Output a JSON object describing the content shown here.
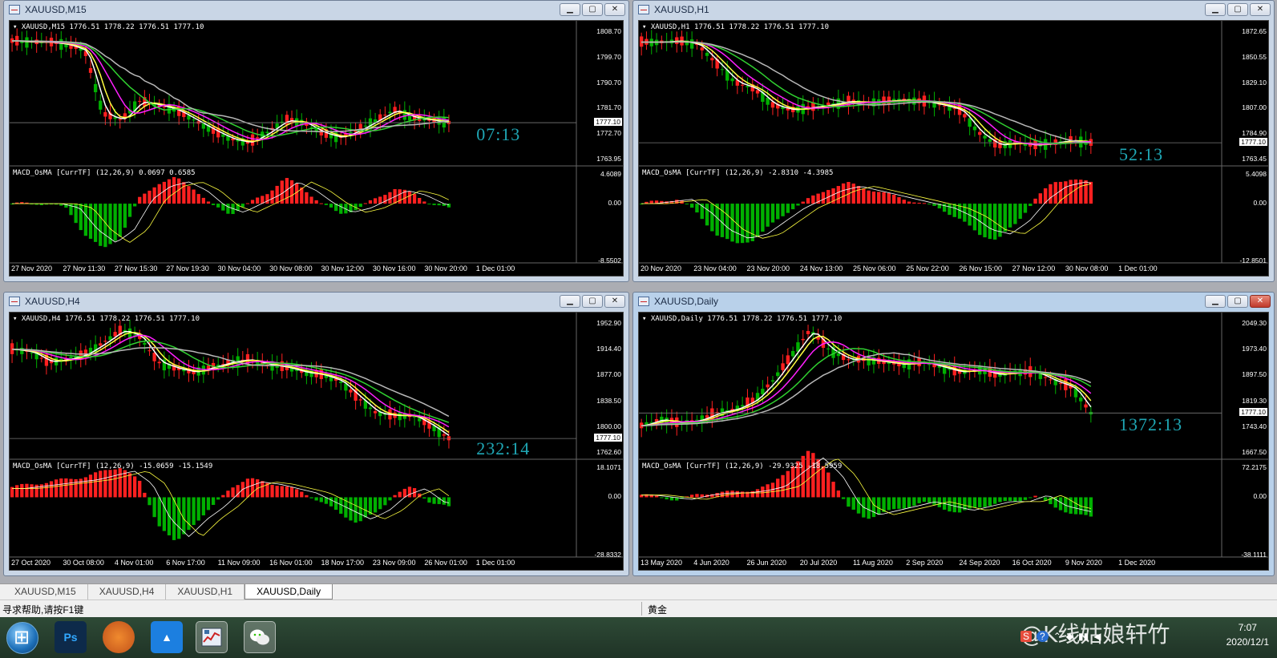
{
  "windows": [
    {
      "id": "m15",
      "title": "XAUUSD,M15",
      "info": "XAUUSD,M15  1776.51 1778.22 1776.51 1777.10",
      "macd_info": "MACD_OsMA [CurrTF] (12,26,9) 0.0697 0.6585",
      "timer": "07:13",
      "current_price": "1777.10",
      "price_labels": [
        "1808.70",
        "1799.70",
        "1790.70",
        "1781.70",
        "1772.70",
        "1763.95"
      ],
      "macd_labels": [
        "4.6089",
        "0.00",
        "-8.5502"
      ],
      "time_labels": [
        "27 Nov 2020",
        "27 Nov 11:30",
        "27 Nov 15:30",
        "27 Nov 19:30",
        "30 Nov 04:00",
        "30 Nov 08:00",
        "30 Nov 12:00",
        "30 Nov 16:00",
        "30 Nov 20:00",
        "1 Dec 01:00"
      ],
      "active": false
    },
    {
      "id": "h1",
      "title": "XAUUSD,H1",
      "info": "XAUUSD,H1  1776.51 1778.22 1776.51 1777.10",
      "macd_info": "MACD_OsMA [CurrTF] (12,26,9) -2.8310 -4.3985",
      "timer": "52:13",
      "current_price": "1777.10",
      "price_labels": [
        "1872.65",
        "1850.55",
        "1829.10",
        "1807.00",
        "1784.90",
        "1763.45"
      ],
      "macd_labels": [
        "5.4098",
        "0.00",
        "-12.8501"
      ],
      "time_labels": [
        "20 Nov 2020",
        "23 Nov 04:00",
        "23 Nov 20:00",
        "24 Nov 13:00",
        "25 Nov 06:00",
        "25 Nov 22:00",
        "26 Nov 15:00",
        "27 Nov 12:00",
        "30 Nov 08:00",
        "1 Dec 01:00"
      ],
      "active": false
    },
    {
      "id": "h4",
      "title": "XAUUSD,H4",
      "info": "XAUUSD,H4  1776.51 1778.22 1776.51 1777.10",
      "macd_info": "MACD_OsMA [CurrTF] (12,26,9) -15.0659 -15.1549",
      "timer": "232:14",
      "current_price": "1777.10",
      "price_labels": [
        "1952.90",
        "1914.40",
        "1877.00",
        "1838.50",
        "1800.00",
        "1762.60"
      ],
      "macd_labels": [
        "18.1071",
        "0.00",
        "-28.8332"
      ],
      "time_labels": [
        "27 Oct 2020",
        "30 Oct 08:00",
        "4 Nov 01:00",
        "6 Nov 17:00",
        "11 Nov 09:00",
        "16 Nov 01:00",
        "18 Nov 17:00",
        "23 Nov 09:00",
        "26 Nov 01:00",
        "1 Dec 01:00"
      ],
      "active": false
    },
    {
      "id": "daily",
      "title": "XAUUSD,Daily",
      "info": "XAUUSD,Daily  1776.51 1778.22 1776.51 1777.10",
      "macd_info": "MACD_OsMA [CurrTF] (12,26,9) -29.9325 -18.5959",
      "timer": "1372:13",
      "current_price": "1777.10",
      "price_labels": [
        "2049.30",
        "1973.40",
        "1897.50",
        "1819.30",
        "1743.40",
        "1667.50"
      ],
      "macd_labels": [
        "72.2175",
        "0.00",
        "-38.1111"
      ],
      "time_labels": [
        "13 May 2020",
        "4 Jun 2020",
        "26 Jun 2020",
        "20 Jul 2020",
        "11 Aug 2020",
        "2 Sep 2020",
        "24 Sep 2020",
        "16 Oct 2020",
        "9 Nov 2020",
        "1 Dec 2020"
      ],
      "active": true
    }
  ],
  "tabs": [
    {
      "label": "XAUUSD,M15",
      "active": false
    },
    {
      "label": "XAUUSD,H4",
      "active": false
    },
    {
      "label": "XAUUSD,H1",
      "active": false
    },
    {
      "label": "XAUUSD,Daily",
      "active": true
    }
  ],
  "status": {
    "help": "寻求帮助,请按F1键",
    "symbol": "黄金"
  },
  "taskbar": {
    "apps": [
      {
        "name": "photoshop",
        "label": "Ps",
        "color": "#0d2a4a"
      },
      {
        "name": "foxmail",
        "label": "🦊",
        "color": "#e0701e"
      },
      {
        "name": "lanhu",
        "label": "▲",
        "color": "#1c7fe0"
      },
      {
        "name": "metatrader",
        "label": "MT",
        "color": "#3a6ea5"
      },
      {
        "name": "wechat",
        "label": "●●",
        "color": "#2dc100"
      }
    ],
    "watermark": "@K线姑娘轩竹",
    "time": "7:07",
    "date": "2020/12/1"
  },
  "colors": {
    "bull": "#00b000",
    "bear": "#ff2020",
    "ma_white": "#ffffff",
    "ma_yellow": "#ffff40",
    "ma_magenta": "#ff20ff",
    "ma_green": "#30d030",
    "ma_silver": "#b8b8b8",
    "timer": "#1fa7b5"
  }
}
